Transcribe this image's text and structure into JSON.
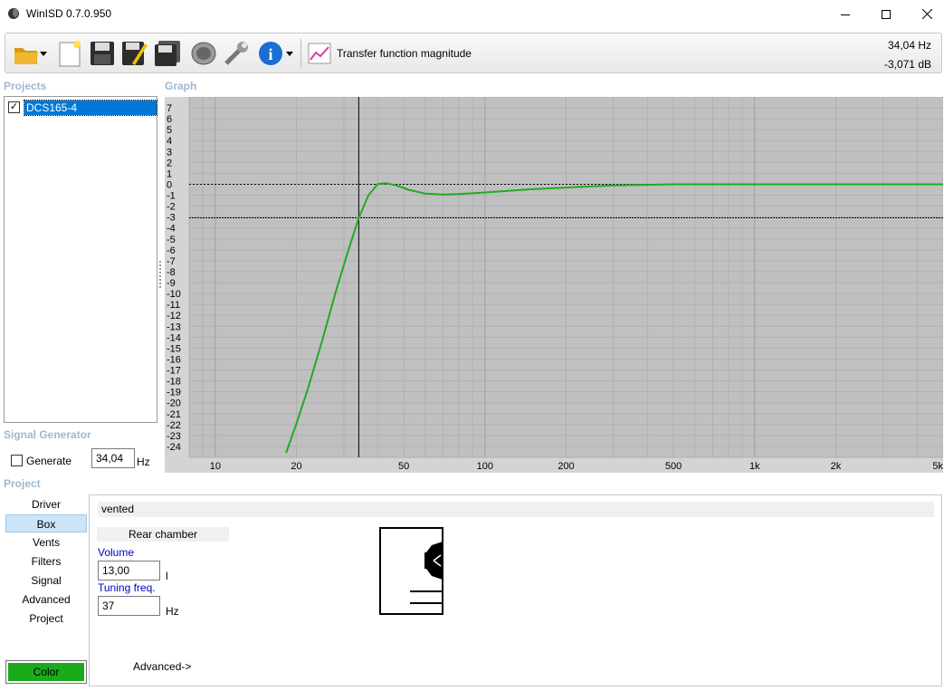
{
  "window": {
    "title": "WinISD 0.7.0.950",
    "controls": [
      "minimize",
      "maximize",
      "close"
    ]
  },
  "toolbar": {
    "icons": [
      "open-folder-icon",
      "dropdown-arrow-icon",
      "new-document-icon",
      "save-icon",
      "save-edit-icon",
      "save-as-icon",
      "driver-speaker-icon",
      "wrench-icon",
      "info-icon",
      "dropdown-arrow-icon",
      "graph-icon"
    ],
    "graph_type_label": "Transfer function magnitude",
    "readout_hz": "34,04 Hz",
    "readout_db": "-3,071 dB"
  },
  "projects": {
    "label": "Projects",
    "items": [
      {
        "name": "DCS165-4",
        "checked": true,
        "selected": true
      }
    ]
  },
  "graph": {
    "label": "Graph",
    "background": "#c0c0c0",
    "curve_color": "#22aa22"
  },
  "chart_data": {
    "type": "line",
    "x_scale": "log",
    "xlim": [
      8,
      5000
    ],
    "ylim": [
      -25,
      8
    ],
    "x_tick_labels": [
      "10",
      "20",
      "50",
      "100",
      "200",
      "500",
      "1k",
      "2k",
      "5k"
    ],
    "x_tick_values": [
      10,
      20,
      50,
      100,
      200,
      500,
      1000,
      2000,
      5000
    ],
    "y_tick_values": [
      7,
      6,
      5,
      4,
      3,
      2,
      1,
      0,
      -1,
      -2,
      -3,
      -4,
      -5,
      -6,
      -7,
      -8,
      -9,
      -10,
      -11,
      -12,
      -13,
      -14,
      -15,
      -16,
      -17,
      -18,
      -19,
      -20,
      -21,
      -22,
      -23,
      -24
    ],
    "grid": true,
    "series": [
      {
        "color": "#22aa22",
        "x": [
          18.3,
          20,
          22,
          25,
          28,
          31,
          34.04,
          37,
          40,
          43,
          47,
          52,
          60,
          70,
          80,
          100,
          150,
          200,
          300,
          500,
          1000,
          2000,
          5000
        ],
        "y": [
          -24.6,
          -21.9,
          -18.8,
          -14.2,
          -9.8,
          -6.2,
          -3.071,
          -1.0,
          0.02,
          0.1,
          -0.1,
          -0.5,
          -0.85,
          -0.95,
          -0.9,
          -0.75,
          -0.45,
          -0.3,
          -0.1,
          0,
          0,
          0,
          0
        ]
      }
    ],
    "cursor": {
      "x": 34.04,
      "y": -3.071
    },
    "reference_line_y": 0
  },
  "signal_generator": {
    "label": "Signal Generator",
    "generate_label": "Generate",
    "generate_checked": false,
    "frequency_value": "34,04",
    "unit": "Hz"
  },
  "project": {
    "label": "Project",
    "nav": [
      "Driver",
      "Box",
      "Vents",
      "Filters",
      "Signal",
      "Advanced",
      "Project"
    ],
    "active_nav": "Box",
    "color_label": "Color",
    "color_value": "#1aaa1a"
  },
  "box": {
    "type": "vented",
    "rear_chamber_label": "Rear chamber",
    "volume_label": "Volume",
    "volume_value": "13,00",
    "volume_unit": "l",
    "tuning_label": "Tuning freq.",
    "tuning_value": "37",
    "tuning_unit": "Hz",
    "advanced_label": "Advanced->"
  }
}
